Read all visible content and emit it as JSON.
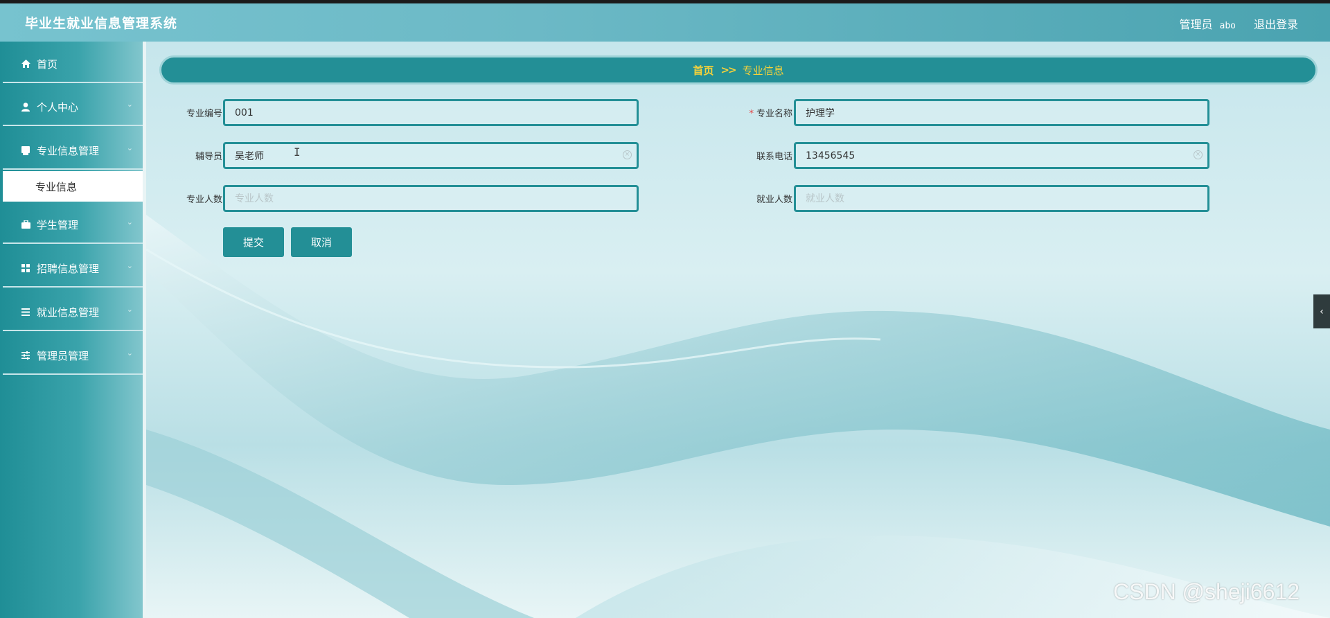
{
  "header": {
    "app_title": "毕业生就业信息管理系统",
    "role_label": "管理员",
    "username": "abo",
    "logout_label": "退出登录"
  },
  "sidebar": {
    "items": [
      {
        "label": "首页",
        "icon": "home-icon"
      },
      {
        "label": "个人中心",
        "icon": "user-icon"
      },
      {
        "label": "专业信息管理",
        "icon": "book-icon"
      },
      {
        "label": "学生管理",
        "icon": "briefcase-icon"
      },
      {
        "label": "招聘信息管理",
        "icon": "grid-icon"
      },
      {
        "label": "就业信息管理",
        "icon": "list-icon"
      },
      {
        "label": "管理员管理",
        "icon": "sliders-icon"
      }
    ],
    "active_sub": "专业信息"
  },
  "breadcrumb": {
    "home": "首页",
    "separator": ">>",
    "current": "专业信息"
  },
  "form": {
    "code": {
      "label": "专业编号",
      "value": "001",
      "placeholder": ""
    },
    "name": {
      "label": "专业名称",
      "value": "护理学",
      "placeholder": "",
      "required": true
    },
    "counselor": {
      "label": "辅导员",
      "value": "吴老师",
      "placeholder": ""
    },
    "phone": {
      "label": "联系电话",
      "value": "13456545",
      "placeholder": ""
    },
    "headcount": {
      "label": "专业人数",
      "value": "",
      "placeholder": "专业人数"
    },
    "employed": {
      "label": "就业人数",
      "value": "",
      "placeholder": "就业人数"
    },
    "submit_label": "提交",
    "cancel_label": "取消"
  },
  "watermark": "CSDN @sheji6612",
  "colors": {
    "accent": "#238f96",
    "breadcrumb_text": "#f6d23a",
    "required": "#e54545"
  }
}
